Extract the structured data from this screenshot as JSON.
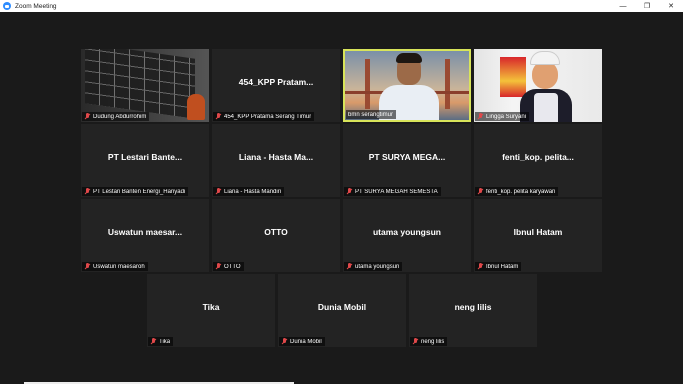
{
  "window": {
    "title": "Zoom Meeting",
    "controls": {
      "minimize": "—",
      "maximize": "❐",
      "close": "✕"
    }
  },
  "colors": {
    "background": "#1a1a1a",
    "tile": "#232323",
    "active_speaker_border": "#d8e45a",
    "muted_mic": "#e0484a"
  },
  "participants": [
    {
      "display": "",
      "tag": "Dudung Abdurrohim",
      "video": "shelves",
      "active": false,
      "muted": true
    },
    {
      "display": "454_KPP Pratam...",
      "tag": "454_KPP Pratama Serang Timur",
      "video": "",
      "active": false,
      "muted": true
    },
    {
      "display": "",
      "tag": "bmn serangtimur",
      "video": "bridge",
      "active": true,
      "muted": false
    },
    {
      "display": "",
      "tag": "Lingga Suryani",
      "video": "kitchen",
      "active": false,
      "muted": true
    },
    {
      "display": "PT Lestari Bante...",
      "tag": "PT Lestari Banten Energi_Hariyadi",
      "video": "",
      "active": false,
      "muted": true
    },
    {
      "display": "Liana - Hasta Ma...",
      "tag": "Liana - Hasta Mandiri",
      "video": "",
      "active": false,
      "muted": true
    },
    {
      "display": "PT SURYA MEGA...",
      "tag": "PT SURYA MEGAH SEMESTA",
      "video": "",
      "active": false,
      "muted": true
    },
    {
      "display": "fenti_kop. pelita...",
      "tag": "fenti_kop. pelita karyawan",
      "video": "",
      "active": false,
      "muted": true
    },
    {
      "display": "Uswatun maesar...",
      "tag": "Uswatun maesaroh",
      "video": "",
      "active": false,
      "muted": true
    },
    {
      "display": "OTTO",
      "tag": "OTTO",
      "video": "",
      "active": false,
      "muted": true
    },
    {
      "display": "utama youngsun",
      "tag": "utama youngsun",
      "video": "",
      "active": false,
      "muted": true
    },
    {
      "display": "Ibnul Hatam",
      "tag": "Ibnul Hatam",
      "video": "",
      "active": false,
      "muted": true
    },
    {
      "display": "Tika",
      "tag": "Tika",
      "video": "",
      "active": false,
      "muted": true
    },
    {
      "display": "Dunia Mobil",
      "tag": "Dunia Mobil",
      "video": "",
      "active": false,
      "muted": true
    },
    {
      "display": "neng lilis",
      "tag": "neng lilis",
      "video": "",
      "active": false,
      "muted": true
    }
  ]
}
